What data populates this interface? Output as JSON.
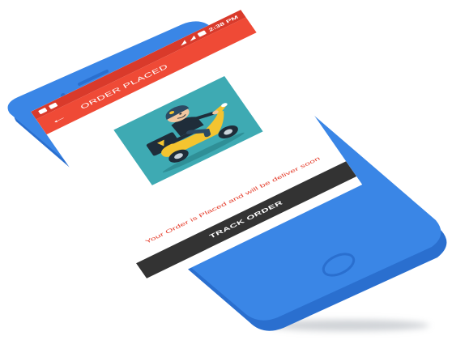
{
  "colors": {
    "phone_body": "#3a86e6",
    "phone_edge": "#2a6fcf",
    "status_bar": "#d93a2b",
    "app_bar": "#ef4a36",
    "illustration_bg": "#3eaab3",
    "message_text": "#e5402f",
    "button_bg": "#333333"
  },
  "status_bar": {
    "time": "2:38 PM",
    "left_icons": [
      "notification-icon",
      "photo-icon"
    ],
    "right_icons": [
      "signal-icon",
      "wifi-icon",
      "battery-icon"
    ]
  },
  "app_bar": {
    "back_icon": "back-arrow-icon",
    "title": "ORDER PLACED"
  },
  "illustration": {
    "subject": "delivery-scooter-icon"
  },
  "message": "Your Order is Placed and will be deliver soon",
  "button": {
    "label": "TRACK ORDER"
  }
}
